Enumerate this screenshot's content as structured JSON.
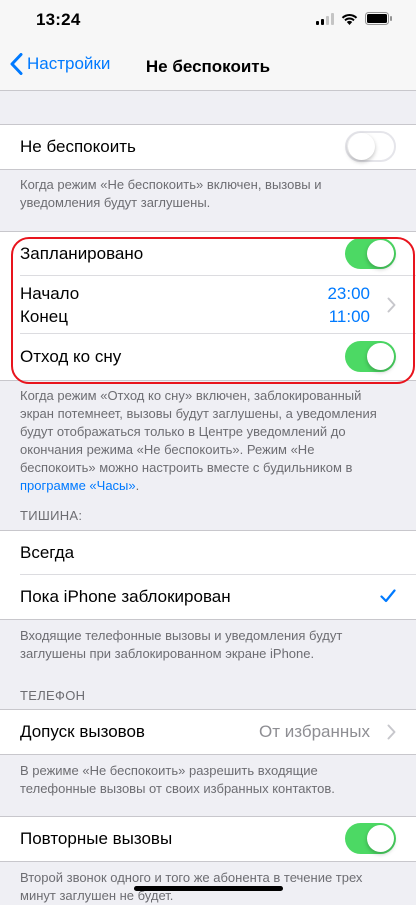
{
  "status": {
    "time": "13:24"
  },
  "nav": {
    "back_label": "Настройки",
    "title": "Не беспокоить"
  },
  "dnd": {
    "label": "Не беспокоить",
    "enabled": false,
    "footer": "Когда режим «Не беспокоить» включен, вызовы и уведомления будут заглушены."
  },
  "schedule": {
    "scheduled_label": "Запланировано",
    "scheduled_on": true,
    "start_label": "Начало",
    "start_value": "23:00",
    "end_label": "Конец",
    "end_value": "11:00",
    "bedtime_label": "Отход ко сну",
    "bedtime_on": true,
    "footer_text": "Когда режим «Отход ко сну» включен, заблокированный экран потемнеет, вызовы будут заглушены, а уведомления будут отображаться только в Центре уведомлений до окончания режима «Не беспокоить». Режим «Не беспокоить» можно настроить вместе с будильником в ",
    "footer_link": "программе «Часы»",
    "footer_end": "."
  },
  "silence": {
    "header": "ТИШИНА:",
    "always_label": "Всегда",
    "locked_label": "Пока iPhone заблокирован",
    "selected": "locked",
    "footer": "Входящие телефонные вызовы и уведомления будут заглушены при заблокированном экране iPhone."
  },
  "phone": {
    "header": "ТЕЛЕФОН",
    "allow_calls_label": "Допуск вызовов",
    "allow_calls_value": "От избранных",
    "footer": "В режиме «Не беспокоить» разрешить входящие телефонные вызовы от своих избранных контактов."
  },
  "repeated": {
    "label": "Повторные вызовы",
    "on": true,
    "footer": "Второй звонок одного и того же абонента в течение трех минут заглушен не будет."
  },
  "colors": {
    "accent": "#007aff",
    "toggle_on": "#4cd964",
    "highlight": "#e8141d"
  },
  "icons": {
    "signal": "cellular-signal-icon",
    "wifi": "wifi-icon",
    "battery": "battery-icon",
    "back": "chevron-left-icon",
    "chevron": "chevron-right-icon",
    "check": "checkmark-icon"
  }
}
